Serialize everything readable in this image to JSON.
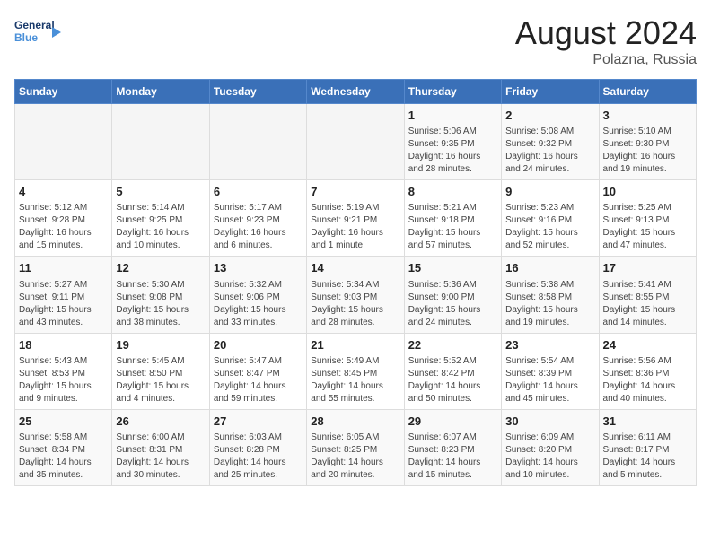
{
  "header": {
    "logo_line1": "General",
    "logo_line2": "Blue",
    "month_year": "August 2024",
    "location": "Polazna, Russia"
  },
  "days_of_week": [
    "Sunday",
    "Monday",
    "Tuesday",
    "Wednesday",
    "Thursday",
    "Friday",
    "Saturday"
  ],
  "weeks": [
    [
      {
        "day": "",
        "info": ""
      },
      {
        "day": "",
        "info": ""
      },
      {
        "day": "",
        "info": ""
      },
      {
        "day": "",
        "info": ""
      },
      {
        "day": "1",
        "info": "Sunrise: 5:06 AM\nSunset: 9:35 PM\nDaylight: 16 hours\nand 28 minutes."
      },
      {
        "day": "2",
        "info": "Sunrise: 5:08 AM\nSunset: 9:32 PM\nDaylight: 16 hours\nand 24 minutes."
      },
      {
        "day": "3",
        "info": "Sunrise: 5:10 AM\nSunset: 9:30 PM\nDaylight: 16 hours\nand 19 minutes."
      }
    ],
    [
      {
        "day": "4",
        "info": "Sunrise: 5:12 AM\nSunset: 9:28 PM\nDaylight: 16 hours\nand 15 minutes."
      },
      {
        "day": "5",
        "info": "Sunrise: 5:14 AM\nSunset: 9:25 PM\nDaylight: 16 hours\nand 10 minutes."
      },
      {
        "day": "6",
        "info": "Sunrise: 5:17 AM\nSunset: 9:23 PM\nDaylight: 16 hours\nand 6 minutes."
      },
      {
        "day": "7",
        "info": "Sunrise: 5:19 AM\nSunset: 9:21 PM\nDaylight: 16 hours\nand 1 minute."
      },
      {
        "day": "8",
        "info": "Sunrise: 5:21 AM\nSunset: 9:18 PM\nDaylight: 15 hours\nand 57 minutes."
      },
      {
        "day": "9",
        "info": "Sunrise: 5:23 AM\nSunset: 9:16 PM\nDaylight: 15 hours\nand 52 minutes."
      },
      {
        "day": "10",
        "info": "Sunrise: 5:25 AM\nSunset: 9:13 PM\nDaylight: 15 hours\nand 47 minutes."
      }
    ],
    [
      {
        "day": "11",
        "info": "Sunrise: 5:27 AM\nSunset: 9:11 PM\nDaylight: 15 hours\nand 43 minutes."
      },
      {
        "day": "12",
        "info": "Sunrise: 5:30 AM\nSunset: 9:08 PM\nDaylight: 15 hours\nand 38 minutes."
      },
      {
        "day": "13",
        "info": "Sunrise: 5:32 AM\nSunset: 9:06 PM\nDaylight: 15 hours\nand 33 minutes."
      },
      {
        "day": "14",
        "info": "Sunrise: 5:34 AM\nSunset: 9:03 PM\nDaylight: 15 hours\nand 28 minutes."
      },
      {
        "day": "15",
        "info": "Sunrise: 5:36 AM\nSunset: 9:00 PM\nDaylight: 15 hours\nand 24 minutes."
      },
      {
        "day": "16",
        "info": "Sunrise: 5:38 AM\nSunset: 8:58 PM\nDaylight: 15 hours\nand 19 minutes."
      },
      {
        "day": "17",
        "info": "Sunrise: 5:41 AM\nSunset: 8:55 PM\nDaylight: 15 hours\nand 14 minutes."
      }
    ],
    [
      {
        "day": "18",
        "info": "Sunrise: 5:43 AM\nSunset: 8:53 PM\nDaylight: 15 hours\nand 9 minutes."
      },
      {
        "day": "19",
        "info": "Sunrise: 5:45 AM\nSunset: 8:50 PM\nDaylight: 15 hours\nand 4 minutes."
      },
      {
        "day": "20",
        "info": "Sunrise: 5:47 AM\nSunset: 8:47 PM\nDaylight: 14 hours\nand 59 minutes."
      },
      {
        "day": "21",
        "info": "Sunrise: 5:49 AM\nSunset: 8:45 PM\nDaylight: 14 hours\nand 55 minutes."
      },
      {
        "day": "22",
        "info": "Sunrise: 5:52 AM\nSunset: 8:42 PM\nDaylight: 14 hours\nand 50 minutes."
      },
      {
        "day": "23",
        "info": "Sunrise: 5:54 AM\nSunset: 8:39 PM\nDaylight: 14 hours\nand 45 minutes."
      },
      {
        "day": "24",
        "info": "Sunrise: 5:56 AM\nSunset: 8:36 PM\nDaylight: 14 hours\nand 40 minutes."
      }
    ],
    [
      {
        "day": "25",
        "info": "Sunrise: 5:58 AM\nSunset: 8:34 PM\nDaylight: 14 hours\nand 35 minutes."
      },
      {
        "day": "26",
        "info": "Sunrise: 6:00 AM\nSunset: 8:31 PM\nDaylight: 14 hours\nand 30 minutes."
      },
      {
        "day": "27",
        "info": "Sunrise: 6:03 AM\nSunset: 8:28 PM\nDaylight: 14 hours\nand 25 minutes."
      },
      {
        "day": "28",
        "info": "Sunrise: 6:05 AM\nSunset: 8:25 PM\nDaylight: 14 hours\nand 20 minutes."
      },
      {
        "day": "29",
        "info": "Sunrise: 6:07 AM\nSunset: 8:23 PM\nDaylight: 14 hours\nand 15 minutes."
      },
      {
        "day": "30",
        "info": "Sunrise: 6:09 AM\nSunset: 8:20 PM\nDaylight: 14 hours\nand 10 minutes."
      },
      {
        "day": "31",
        "info": "Sunrise: 6:11 AM\nSunset: 8:17 PM\nDaylight: 14 hours\nand 5 minutes."
      }
    ]
  ]
}
